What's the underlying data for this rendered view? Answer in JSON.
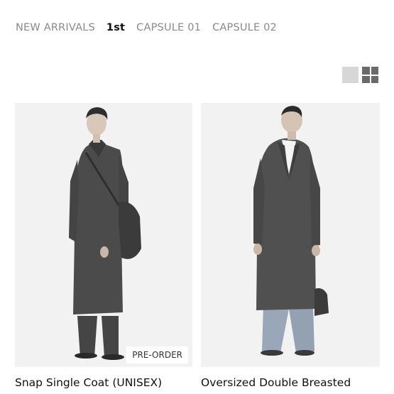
{
  "nav": {
    "tabs": [
      "NEW ARRIVALS",
      "1st",
      "CAPSULE 01",
      "CAPSULE 02"
    ],
    "active_tab": "1st"
  },
  "view_toggle": {
    "options": [
      "single-view-icon",
      "grid-view-icon"
    ],
    "selected": "grid"
  },
  "products": [
    {
      "name": "Snap Single Coat (UNISEX)",
      "badge": "PRE-ORDER"
    },
    {
      "name": "Oversized Double Breasted",
      "badge": ""
    }
  ],
  "colors": {
    "photo_bg": "#f2f2f2",
    "coat": "#4a4a4a",
    "jeans": "#9aa7b8",
    "active_tab": "#111111",
    "inactive_tab": "#8a8a8a"
  }
}
